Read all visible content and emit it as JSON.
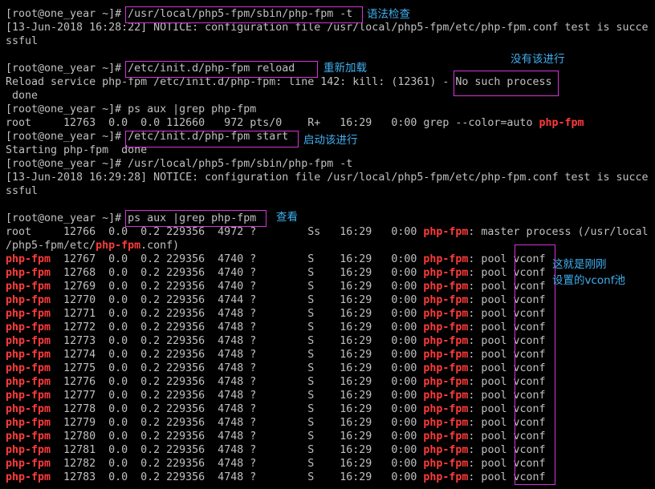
{
  "colors": {
    "background": "#000000",
    "text": "#c0c0c0",
    "highlight": "#ff3b3b",
    "annotation_box": "#d633d6",
    "annotation_text": "#3fb0f0"
  },
  "terminal": {
    "lines": [
      {
        "text": "[root@one_year ~]# /usr/local/php5-fpm/sbin/php-fpm -t"
      },
      {
        "text": "[13-Jun-2018 16:28:22] NOTICE: configuration file /usr/local/php5-fpm/etc/php-fpm.conf test is succe"
      },
      {
        "text": "ssful"
      },
      {
        "text": ""
      },
      {
        "text": "[root@one_year ~]# /etc/init.d/php-fpm reload"
      },
      {
        "text": "Reload service php-fpm /etc/init.d/php-fpm: line 142: kill: (12361) - No such process"
      },
      {
        "text": " done"
      },
      {
        "text": "[root@one_year ~]# ps aux |grep php-fpm"
      },
      {
        "text": "root     12763  0.0  0.0 112660   972 pts/0    R+   16:29   0:00 grep --color=auto ",
        "hl": "php-fpm"
      },
      {
        "text": "[root@one_year ~]# /etc/init.d/php-fpm start"
      },
      {
        "text": "Starting php-fpm  done"
      },
      {
        "text": "[root@one_year ~]# /usr/local/php5-fpm/sbin/php-fpm -t"
      },
      {
        "text": "[13-Jun-2018 16:29:28] NOTICE: configuration file /usr/local/php5-fpm/etc/php-fpm.conf test is succe"
      },
      {
        "text": "ssful"
      },
      {
        "text": ""
      },
      {
        "text": "[root@one_year ~]# ps aux |grep php-fpm"
      },
      {
        "text": "root     12766  0.0  0.2 229356  4972 ?        Ss   16:29   0:00 ",
        "hl": "php-fpm",
        "rest": ": master process (/usr/local"
      },
      {
        "text": "/php5-fpm/etc/",
        "hl": "php-fpm",
        "rest": ".conf)"
      },
      {
        "lead": "php-fpm",
        "text": "  12767  0.0  0.2 229356  4740 ?        S    16:29   0:00 ",
        "hl": "php-fpm",
        "rest": ": pool vconf"
      },
      {
        "lead": "php-fpm",
        "text": "  12768  0.0  0.2 229356  4740 ?        S    16:29   0:00 ",
        "hl": "php-fpm",
        "rest": ": pool vconf"
      },
      {
        "lead": "php-fpm",
        "text": "  12769  0.0  0.2 229356  4740 ?        S    16:29   0:00 ",
        "hl": "php-fpm",
        "rest": ": pool vconf"
      },
      {
        "lead": "php-fpm",
        "text": "  12770  0.0  0.2 229356  4744 ?        S    16:29   0:00 ",
        "hl": "php-fpm",
        "rest": ": pool vconf"
      },
      {
        "lead": "php-fpm",
        "text": "  12771  0.0  0.2 229356  4748 ?        S    16:29   0:00 ",
        "hl": "php-fpm",
        "rest": ": pool vconf"
      },
      {
        "lead": "php-fpm",
        "text": "  12772  0.0  0.2 229356  4748 ?        S    16:29   0:00 ",
        "hl": "php-fpm",
        "rest": ": pool vconf"
      },
      {
        "lead": "php-fpm",
        "text": "  12773  0.0  0.2 229356  4748 ?        S    16:29   0:00 ",
        "hl": "php-fpm",
        "rest": ": pool vconf"
      },
      {
        "lead": "php-fpm",
        "text": "  12774  0.0  0.2 229356  4748 ?        S    16:29   0:00 ",
        "hl": "php-fpm",
        "rest": ": pool vconf"
      },
      {
        "lead": "php-fpm",
        "text": "  12775  0.0  0.2 229356  4748 ?        S    16:29   0:00 ",
        "hl": "php-fpm",
        "rest": ": pool vconf"
      },
      {
        "lead": "php-fpm",
        "text": "  12776  0.0  0.2 229356  4748 ?        S    16:29   0:00 ",
        "hl": "php-fpm",
        "rest": ": pool vconf"
      },
      {
        "lead": "php-fpm",
        "text": "  12777  0.0  0.2 229356  4748 ?        S    16:29   0:00 ",
        "hl": "php-fpm",
        "rest": ": pool vconf"
      },
      {
        "lead": "php-fpm",
        "text": "  12778  0.0  0.2 229356  4748 ?        S    16:29   0:00 ",
        "hl": "php-fpm",
        "rest": ": pool vconf"
      },
      {
        "lead": "php-fpm",
        "text": "  12779  0.0  0.2 229356  4748 ?        S    16:29   0:00 ",
        "hl": "php-fpm",
        "rest": ": pool vconf"
      },
      {
        "lead": "php-fpm",
        "text": "  12780  0.0  0.2 229356  4748 ?        S    16:29   0:00 ",
        "hl": "php-fpm",
        "rest": ": pool vconf"
      },
      {
        "lead": "php-fpm",
        "text": "  12781  0.0  0.2 229356  4748 ?        S    16:29   0:00 ",
        "hl": "php-fpm",
        "rest": ": pool vconf"
      },
      {
        "lead": "php-fpm",
        "text": "  12782  0.0  0.2 229356  4748 ?        S    16:29   0:00 ",
        "hl": "php-fpm",
        "rest": ": pool vconf"
      },
      {
        "lead": "php-fpm",
        "text": "  12783  0.0  0.2 229356  4748 ?        S    16:29   0:00 ",
        "hl": "php-fpm",
        "rest": ": pool vconf"
      }
    ]
  },
  "annotations": {
    "syntax_check": "语法检查",
    "reload": "重新加载",
    "no_process": "没有该进行",
    "start": "启动该进行",
    "view": "查看",
    "vconf_pool": "这就是刚刚\n设置的vconf池"
  }
}
